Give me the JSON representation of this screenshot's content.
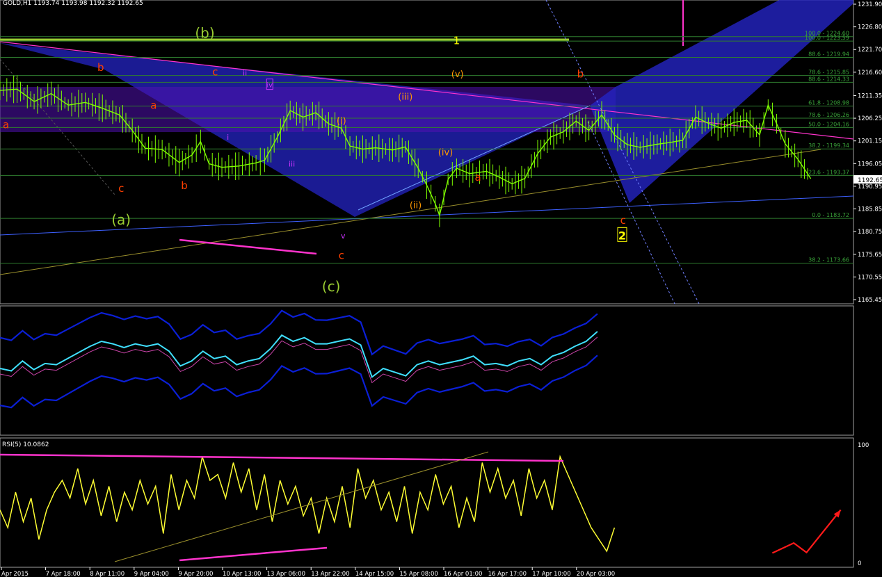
{
  "header": {
    "symbol_line": "GOLD,H1  1193.74 1193.98 1192.32 1192.65"
  },
  "rsi_header": "RSI(5) 10.0862",
  "colors": {
    "background": "#000000",
    "grid": "#ffffff",
    "candle": "#7fff00",
    "fib": "#2f7d2f",
    "fib_text": "#3aa53a",
    "band": "#0b1fd6",
    "rsi": "#ffff33",
    "wave_red": "#ff4000",
    "wave_green": "#9acd32",
    "wave_purple": "#cc33ff",
    "wave_orange": "#ff9900",
    "magenta": "#ff33cc"
  },
  "chart_data": {
    "type": "candlestick",
    "symbol": "GOLD",
    "timeframe": "H1",
    "last_price": "1192.65",
    "ylim": [
      1165.45,
      1231.9
    ],
    "y_ticks": [
      "1231.90",
      "1226.80",
      "1221.70",
      "1216.60",
      "1211.35",
      "1206.25",
      "1201.15",
      "1196.05",
      "1190.95",
      "1185.85",
      "1180.75",
      "1175.65",
      "1170.55",
      "1165.45"
    ],
    "x_ticks": [
      "Apr 2015",
      "7 Apr 18:00",
      "8 Apr 11:00",
      "9 Apr 04:00",
      "9 Apr 20:00",
      "10 Apr 13:00",
      "13 Apr 06:00",
      "13 Apr 22:00",
      "14 Apr 15:00",
      "15 Apr 08:00",
      "16 Apr 01:00",
      "16 Apr 17:00",
      "17 Apr 10:00",
      "20 Apr 03:00"
    ],
    "price_path": [
      [
        0,
        1212.5
      ],
      [
        0.02,
        1212.8
      ],
      [
        0.04,
        1210
      ],
      [
        0.06,
        1211.8
      ],
      [
        0.08,
        1209.2
      ],
      [
        0.1,
        1209.8
      ],
      [
        0.12,
        1208.5
      ],
      [
        0.14,
        1207
      ],
      [
        0.155,
        1203.5
      ],
      [
        0.17,
        1199.5
      ],
      [
        0.19,
        1199.2
      ],
      [
        0.21,
        1196.3
      ],
      [
        0.225,
        1198
      ],
      [
        0.235,
        1201
      ],
      [
        0.245,
        1196
      ],
      [
        0.26,
        1195.2
      ],
      [
        0.28,
        1195.5
      ],
      [
        0.3,
        1196.2
      ],
      [
        0.31,
        1196.8
      ],
      [
        0.325,
        1202
      ],
      [
        0.34,
        1208
      ],
      [
        0.355,
        1206.5
      ],
      [
        0.37,
        1207.5
      ],
      [
        0.385,
        1205
      ],
      [
        0.4,
        1204
      ],
      [
        0.41,
        1200
      ],
      [
        0.425,
        1199.3
      ],
      [
        0.44,
        1199.6
      ],
      [
        0.46,
        1199.1
      ],
      [
        0.475,
        1199.8
      ],
      [
        0.49,
        1195
      ],
      [
        0.5,
        1191.2
      ],
      [
        0.51,
        1187
      ],
      [
        0.515,
        1184.4
      ],
      [
        0.525,
        1192.5
      ],
      [
        0.535,
        1195
      ],
      [
        0.55,
        1193.8
      ],
      [
        0.57,
        1194.3
      ],
      [
        0.585,
        1193
      ],
      [
        0.6,
        1191.5
      ],
      [
        0.615,
        1192.7
      ],
      [
        0.63,
        1198.3
      ],
      [
        0.645,
        1202
      ],
      [
        0.66,
        1203.2
      ],
      [
        0.675,
        1205.6
      ],
      [
        0.69,
        1203.5
      ],
      [
        0.705,
        1207
      ],
      [
        0.72,
        1202.5
      ],
      [
        0.735,
        1200.3
      ],
      [
        0.75,
        1199.7
      ],
      [
        0.77,
        1200.4
      ],
      [
        0.785,
        1200.8
      ],
      [
        0.8,
        1201.3
      ],
      [
        0.815,
        1206.5
      ],
      [
        0.83,
        1205.1
      ],
      [
        0.845,
        1204
      ],
      [
        0.86,
        1205.3
      ],
      [
        0.875,
        1205.8
      ],
      [
        0.89,
        1202.5
      ],
      [
        0.9,
        1209.2
      ],
      [
        0.91,
        1205
      ],
      [
        0.92,
        1200.5
      ],
      [
        0.935,
        1197
      ],
      [
        0.95,
        1192.65
      ]
    ],
    "fib_levels": [
      {
        "label": "100.0 - 1224.60",
        "value": 1224.6
      },
      {
        "label": "100.0 - 1223.59",
        "value": 1223.59
      },
      {
        "label": "88.6 - 1219.94",
        "value": 1219.94
      },
      {
        "label": "78.6 - 1215.85",
        "value": 1215.85
      },
      {
        "label": "88.6 - 1214.33",
        "value": 1214.33
      },
      {
        "label": "61.8 - 1208.98",
        "value": 1208.98
      },
      {
        "label": "78.6 - 1206.26",
        "value": 1206.26
      },
      {
        "label": "50.0 - 1204.16",
        "value": 1204.16
      },
      {
        "label": "38.2 - 1199.34",
        "value": 1199.34
      },
      {
        "label": "23.6 - 1193.37",
        "value": 1193.37
      },
      {
        "label": "0.0 - 1183.72",
        "value": 1183.72
      },
      {
        "label": "38.2 - 1173.66",
        "value": 1173.66
      }
    ],
    "wave_labels": [
      {
        "text": "(b)",
        "color": "wave_green",
        "x": 0.24,
        "y": 1224.3,
        "size": 20
      },
      {
        "text": "1",
        "color": "wave_yellow",
        "x": 0.535,
        "y": 1222.9,
        "size": 15
      },
      {
        "text": "b",
        "color": "wave_red",
        "x": 0.118,
        "y": 1216.9,
        "size": 15
      },
      {
        "text": "c",
        "color": "wave_red",
        "x": 0.252,
        "y": 1215.9,
        "size": 15
      },
      {
        "text": "ii",
        "color": "wave_purple",
        "x": 0.287,
        "y": 1215.9,
        "size": 11
      },
      {
        "text": "(v)",
        "color": "wave_orange",
        "x": 0.536,
        "y": 1215.5,
        "size": 13
      },
      {
        "text": "b",
        "color": "wave_red",
        "x": 0.68,
        "y": 1215.4,
        "size": 15
      },
      {
        "text": "(iii)",
        "color": "wave_orange",
        "x": 0.475,
        "y": 1210.4,
        "size": 13
      },
      {
        "text": "a",
        "color": "wave_red",
        "x": 0.18,
        "y": 1208.4,
        "size": 15
      },
      {
        "text": "(i)",
        "color": "wave_orange",
        "x": 0.4,
        "y": 1205.0,
        "size": 13
      },
      {
        "text": "a",
        "color": "wave_red",
        "x": 0.007,
        "y": 1204.0,
        "size": 15
      },
      {
        "text": "i",
        "color": "wave_purple",
        "x": 0.267,
        "y": 1201.4,
        "size": 11
      },
      {
        "text": "(iv)",
        "color": "wave_orange",
        "x": 0.522,
        "y": 1197.9,
        "size": 13
      },
      {
        "text": "iii",
        "color": "wave_purple",
        "x": 0.342,
        "y": 1195.4,
        "size": 11
      },
      {
        "text": "a",
        "color": "wave_red",
        "x": 0.56,
        "y": 1192.2,
        "size": 15
      },
      {
        "text": "b",
        "color": "wave_red",
        "x": 0.216,
        "y": 1190.3,
        "size": 15
      },
      {
        "text": "c",
        "color": "wave_red",
        "x": 0.142,
        "y": 1189.7,
        "size": 15
      },
      {
        "text": "(ii)",
        "color": "wave_orange",
        "x": 0.487,
        "y": 1186.0,
        "size": 13
      },
      {
        "text": "(a)",
        "color": "wave_green",
        "x": 0.142,
        "y": 1182.3,
        "size": 20
      },
      {
        "text": "c",
        "color": "wave_red",
        "x": 0.73,
        "y": 1182.5,
        "size": 15
      },
      {
        "text": "v",
        "color": "wave_purple",
        "x": 0.402,
        "y": 1179.2,
        "size": 11
      },
      {
        "text": "c",
        "color": "wave_red",
        "x": 0.4,
        "y": 1174.6,
        "size": 15
      },
      {
        "text": "(c)",
        "color": "wave_green",
        "x": 0.388,
        "y": 1167.3,
        "size": 20
      }
    ],
    "boxed_labels": [
      {
        "text": "iv",
        "x": 0.316,
        "y": 1213.2,
        "color": "wave_purple"
      },
      {
        "text": "2",
        "x": 0.729,
        "y": 1179.0,
        "color": "wave_yellow"
      }
    ],
    "indicator": {
      "name": "Bands",
      "main": [
        0.52,
        0.5,
        0.58,
        0.51,
        0.56,
        0.55,
        0.6,
        0.65,
        0.7,
        0.74,
        0.72,
        0.69,
        0.72,
        0.7,
        0.72,
        0.66,
        0.54,
        0.58,
        0.66,
        0.6,
        0.62,
        0.55,
        0.58,
        0.6,
        0.68,
        0.79,
        0.74,
        0.77,
        0.72,
        0.72,
        0.74,
        0.76,
        0.71,
        0.45,
        0.52,
        0.49,
        0.46,
        0.55,
        0.58,
        0.55,
        0.57,
        0.59,
        0.62,
        0.55,
        0.56,
        0.54,
        0.58,
        0.6,
        0.55,
        0.62,
        0.65,
        0.7,
        0.74,
        0.82
      ]
    },
    "rsi": {
      "ylim": [
        0,
        100
      ],
      "levels": [
        "100",
        "0"
      ],
      "values": [
        45,
        30,
        60,
        35,
        55,
        20,
        45,
        60,
        70,
        55,
        80,
        50,
        70,
        40,
        65,
        35,
        60,
        45,
        70,
        50,
        65,
        25,
        75,
        45,
        70,
        55,
        90,
        70,
        75,
        55,
        85,
        60,
        80,
        45,
        75,
        35,
        70,
        50,
        65,
        40,
        55,
        25,
        55,
        35,
        65,
        30,
        80,
        55,
        70,
        45,
        60,
        35,
        65,
        25,
        60,
        45,
        75,
        50,
        65,
        30,
        55,
        35,
        85,
        60,
        80,
        55,
        70,
        40,
        80,
        55,
        70,
        45,
        90,
        75,
        60,
        45,
        30,
        20,
        10,
        30
      ]
    },
    "forecast_arrows": [
      [
        0.905,
        0.085
      ],
      [
        0.93,
        0.17
      ],
      [
        0.945,
        0.09
      ],
      [
        0.985,
        0.45
      ]
    ]
  }
}
